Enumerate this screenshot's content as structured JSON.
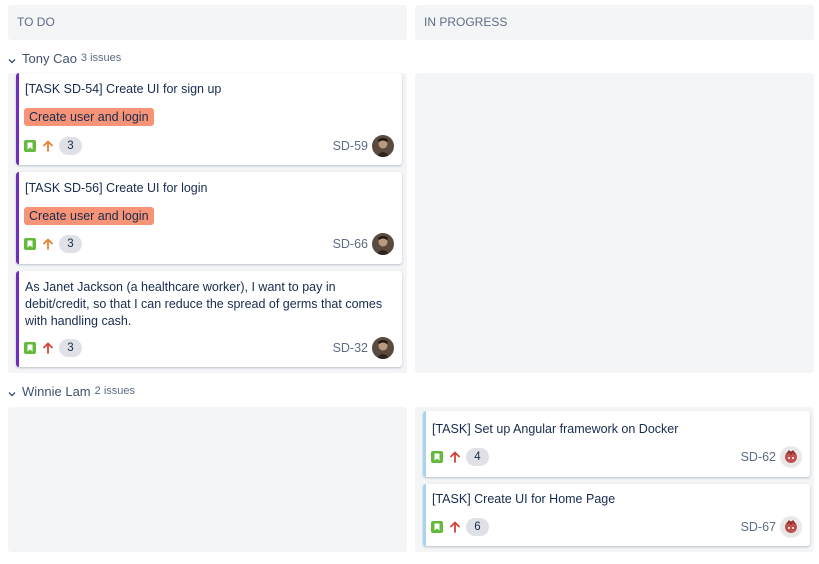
{
  "columns": [
    {
      "title": "TO DO"
    },
    {
      "title": "IN PROGRESS"
    }
  ],
  "colors": {
    "epic_bar": "#6e2dbf",
    "blue_bar": "#a8d3f0",
    "epic_label_bg": "#f79377",
    "story_icon": "#63ba3c",
    "priority_high": "#e97f33",
    "priority_highest": "#d04437",
    "column_bg": "#f4f5f7"
  },
  "swimlanes": [
    {
      "name": "Tony Cao",
      "count": "3 issues",
      "cards": [
        {
          "summary": "[TASK SD-54] Create UI for sign up",
          "epic": "Create user and login",
          "points": "3",
          "key": "SD-59",
          "priority": "high-icon",
          "type": "story-icon",
          "avatar": "tony-avatar"
        },
        {
          "summary": "[TASK SD-56] Create UI for login",
          "epic": "Create user and login",
          "points": "3",
          "key": "SD-66",
          "priority": "high-icon",
          "type": "story-icon",
          "avatar": "tony-avatar"
        },
        {
          "summary": "As Janet Jackson (a healthcare worker), I want to pay in debit/credit, so that I can reduce the spread of germs that comes with handling cash.",
          "epic": "",
          "points": "3",
          "key": "SD-32",
          "priority": "highest-icon",
          "type": "story-icon",
          "avatar": "tony-avatar"
        }
      ]
    },
    {
      "name": "Winnie Lam",
      "count": "2 issues",
      "cards": [
        {
          "summary": "[TASK] Set up Angular framework on Docker",
          "epic": "",
          "points": "4",
          "key": "SD-62",
          "priority": "highest-icon",
          "type": "story-icon",
          "avatar": "winnie-avatar"
        },
        {
          "summary": "[TASK] Create UI for Home Page",
          "epic": "",
          "points": "6",
          "key": "SD-67",
          "priority": "highest-icon",
          "type": "story-icon",
          "avatar": "winnie-avatar"
        }
      ]
    }
  ]
}
